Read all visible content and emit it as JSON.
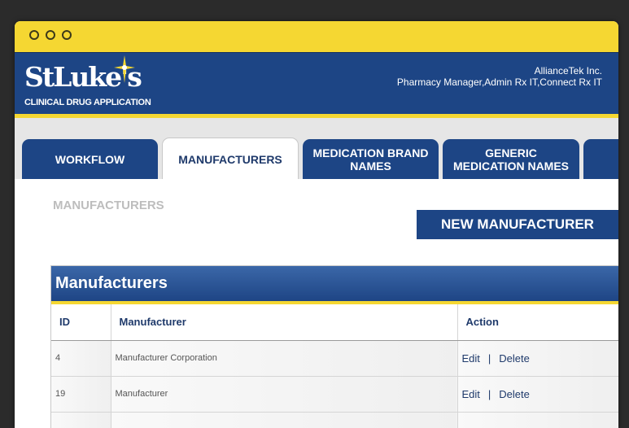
{
  "app": {
    "logo_name": "StLuke's",
    "logo_subtitle": "CLINICAL DRUG APPLICATION",
    "org_name": "AllianceTek Inc.",
    "user_roles": "Pharmacy Manager,Admin Rx IT,Connect Rx IT"
  },
  "tabs": [
    {
      "label": "WORKFLOW"
    },
    {
      "label": "MANUFACTURERS",
      "active": true
    },
    {
      "label": "MEDICATION BRAND NAMES"
    },
    {
      "label": "GENERIC MEDICATION NAMES"
    }
  ],
  "page": {
    "title": "MANUFACTURERS",
    "new_button": "NEW MANUFACTURER",
    "panel_title": "Manufacturers"
  },
  "table": {
    "headers": [
      "ID",
      "Manufacturer",
      "Action"
    ],
    "rows": [
      {
        "id": "4",
        "name": "Manufacturer Corporation",
        "edit": "Edit",
        "sep": "|",
        "delete": "Delete"
      },
      {
        "id": "19",
        "name": "Manufacturer",
        "edit": "Edit",
        "sep": "|",
        "delete": "Delete"
      },
      {
        "id": "",
        "name": "",
        "edit": "",
        "sep": "",
        "delete": ""
      }
    ]
  },
  "colors": {
    "brand_blue": "#1d4585",
    "accent_yellow": "#f5d732"
  }
}
